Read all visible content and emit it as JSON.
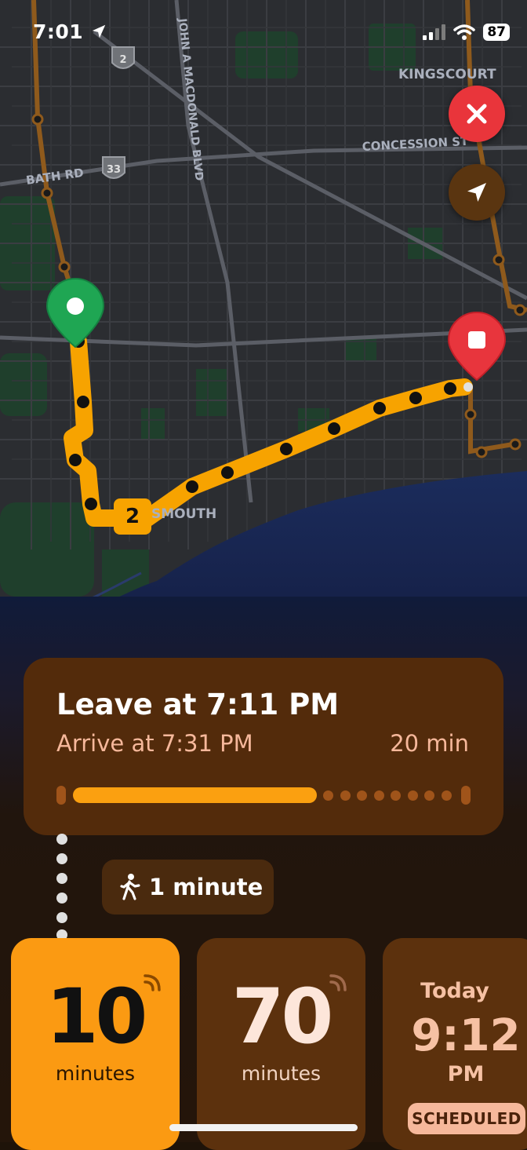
{
  "status_bar": {
    "time": "7:01",
    "battery": "87"
  },
  "map": {
    "street_labels": [
      "BATH RD",
      "JOHN A MACDONALD BLVD",
      "CONCESSION ST",
      "KINGSCOURT",
      "SMOUTH"
    ],
    "highway_shields": [
      "2",
      "33"
    ],
    "route_number": "2",
    "route_color": "#f7a300",
    "origin_pin_color": "#1fa653",
    "destination_pin_color": "#e8353d"
  },
  "controls": {
    "close_icon": "close-icon",
    "locate_icon": "location-arrow-icon"
  },
  "trip": {
    "leave_label": "Leave at 7:11 PM",
    "arrive_label": "Arrive at 7:31 PM",
    "duration": "20 min",
    "progress_fraction": 0.64
  },
  "walk": {
    "label": "1 minute",
    "icon": "walking-person-icon"
  },
  "departures": [
    {
      "value": "10",
      "unit": "minutes",
      "realtime": true
    },
    {
      "value": "70",
      "unit": "minutes",
      "realtime": true
    },
    {
      "day": "Today",
      "time": "9:12",
      "ampm": "PM",
      "badge": "SCHEDULED"
    }
  ],
  "colors": {
    "accent": "#fb9a12",
    "card": "#532b0b",
    "salmon": "#f6b89b"
  }
}
